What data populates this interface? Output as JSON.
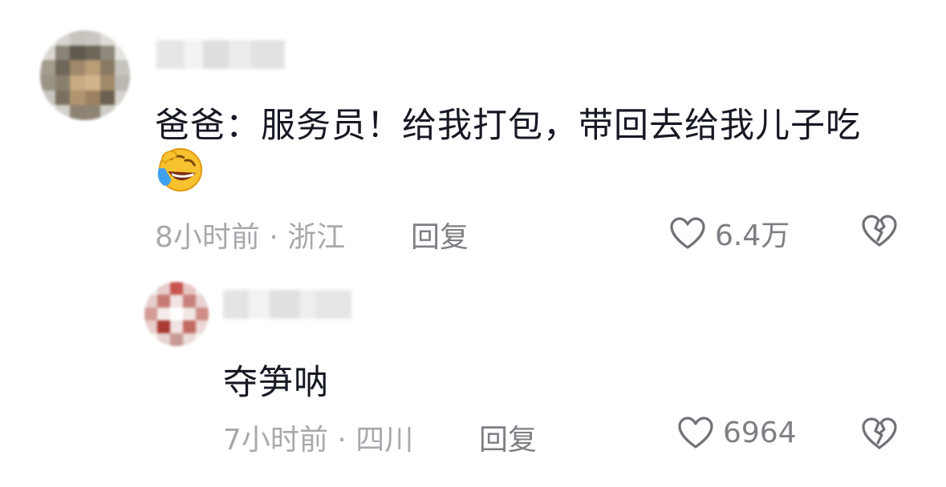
{
  "comments": [
    {
      "text": "爸爸：服务员！给我打包，带回去给我儿子吃",
      "emoji": "laughing-crying-emoji",
      "time_location": "8小时前 · 浙江",
      "reply_label": "回复",
      "likes": "6.4万"
    },
    {
      "text": "夺笋呐",
      "time_location": "7小时前 · 四川",
      "reply_label": "回复",
      "likes": "6964"
    }
  ],
  "icons": {
    "like": "heart-outline-icon",
    "dislike": "broken-heart-outline-icon"
  },
  "colors": {
    "text": "#161823",
    "meta": "#a7a9ad",
    "action": "#7d7f84",
    "icon": "#6f7177"
  }
}
